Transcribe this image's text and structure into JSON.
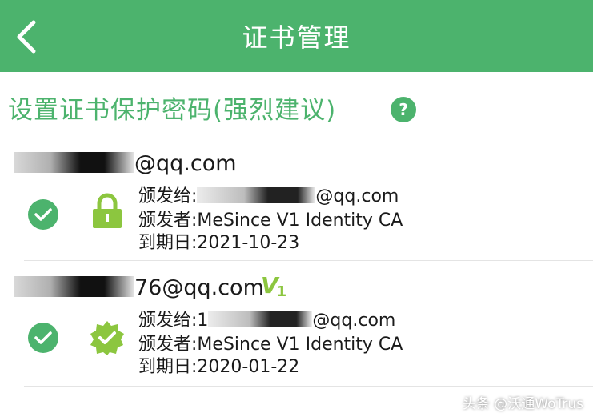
{
  "header": {
    "title": "证书管理",
    "bg_color": "#4cb36d"
  },
  "password_prompt": {
    "label": "设置证书保护密码(强烈建议)",
    "help_label": "?"
  },
  "certificates": [
    {
      "email_suffix": "@qq.com",
      "issued_to_label": "颁发给:",
      "issued_to_suffix": "@qq.com",
      "issuer_label": "颁发者:",
      "issuer": "MeSince V1 Identity CA",
      "expiry_label": "到期日:",
      "expiry": "2021-10-23",
      "status_icon": "check-circle-icon",
      "type_icon": "lock-icon"
    },
    {
      "email_suffix": "76@qq.com",
      "issued_to_label": "颁发给:",
      "issued_to_prefix": "1",
      "issued_to_suffix": "@qq.com",
      "issuer_label": "颁发者:",
      "issuer": "MeSince V1 Identity CA",
      "expiry_label": "到期日:",
      "expiry": "2020-01-22",
      "status_icon": "check-circle-icon",
      "type_icon": "verified-badge-icon",
      "logo_text": "V",
      "logo_sub": "1"
    }
  ],
  "watermark": "头条 @沃通WoTrus",
  "accent_color": "#4cb36d"
}
